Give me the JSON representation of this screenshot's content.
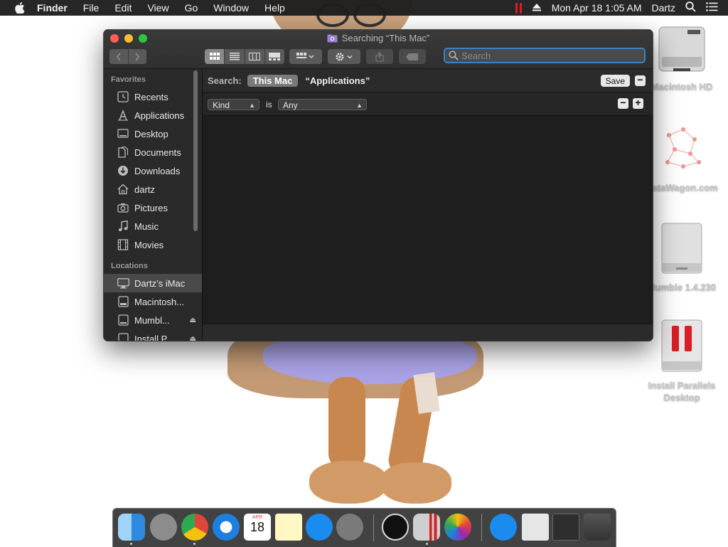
{
  "menubar": {
    "app_name": "Finder",
    "menus": [
      "File",
      "Edit",
      "View",
      "Go",
      "Window",
      "Help"
    ],
    "datetime": "Mon Apr 18  1:05 AM",
    "user": "Dartz"
  },
  "window": {
    "title": "Searching “This Mac”",
    "search": {
      "placeholder": "Search",
      "value": ""
    }
  },
  "sidebar": {
    "favorites_heading": "Favorites",
    "favorites": [
      {
        "label": "Recents",
        "icon": "clock-icon"
      },
      {
        "label": "Applications",
        "icon": "applications-icon"
      },
      {
        "label": "Desktop",
        "icon": "desktop-icon"
      },
      {
        "label": "Documents",
        "icon": "documents-icon"
      },
      {
        "label": "Downloads",
        "icon": "downloads-icon"
      },
      {
        "label": "dartz",
        "icon": "home-icon"
      },
      {
        "label": "Pictures",
        "icon": "camera-icon"
      },
      {
        "label": "Music",
        "icon": "music-note-icon"
      },
      {
        "label": "Movies",
        "icon": "film-icon"
      }
    ],
    "locations_heading": "Locations",
    "locations": [
      {
        "label": "Dartz’s iMac",
        "icon": "computer-icon",
        "selected": true
      },
      {
        "label": "Macintosh...",
        "icon": "hard-drive-icon"
      },
      {
        "label": "Mumbl...",
        "icon": "disk-icon",
        "eject": true
      },
      {
        "label": "Install P...",
        "icon": "disk-icon",
        "eject": true
      }
    ]
  },
  "search_bar": {
    "label": "Search:",
    "scope_this_mac": "This Mac",
    "scope_applications": "“Applications”",
    "save_label": "Save"
  },
  "criteria": {
    "attribute": "Kind",
    "operator": "is",
    "value": "Any"
  },
  "desktop_icons": [
    {
      "label": "Macintosh HD"
    },
    {
      "label": "DataWagon.com"
    },
    {
      "label": "Mumble 1.4.230"
    },
    {
      "label": "Install Parallels Desktop"
    }
  ],
  "dock": {
    "calendar_month": "APR",
    "calendar_day": "18",
    "items": [
      "Finder",
      "Launchpad",
      "Chrome",
      "Safari",
      "Calendar",
      "Notes",
      "App Store",
      "System Preferences",
      "Mumble",
      "Parallels",
      "Photos",
      "Applications",
      "Documents",
      "Downloads",
      "Trash"
    ]
  },
  "colors": {
    "window_bg": "#1e1e1e",
    "search_focus": "#3b82c9",
    "parallels_red": "#d81f26"
  }
}
